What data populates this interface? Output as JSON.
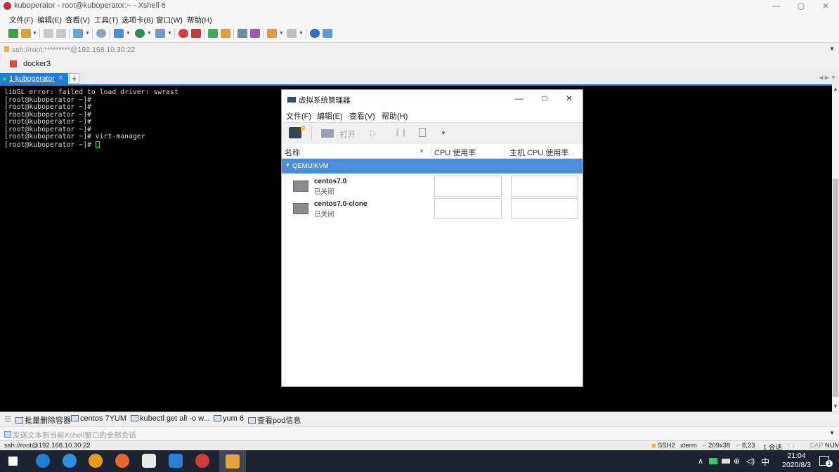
{
  "window": {
    "title": "kuboperator - root@kuboperator:~ - Xshell 6",
    "controls": [
      "—",
      "▢",
      "✕"
    ]
  },
  "menubar": [
    "文件(F)",
    "编辑(E)",
    "查看(V)",
    "工具(T)",
    "选项卡(B)",
    "窗口(W)",
    "帮助(H)"
  ],
  "address": "ssh://root:*********@192.168.10.30:22",
  "session_bar": {
    "label": "docker3"
  },
  "tabs": [
    {
      "label": "1 kuboperator",
      "close": "×"
    }
  ],
  "add_tab": "+",
  "terminal": {
    "lines": [
      "libGL error: failed to load driver: swrast",
      "[root@kuboperator ~]#",
      "[root@kuboperator ~]#",
      "[root@kuboperator ~]#",
      "[root@kuboperator ~]#",
      "[root@kuboperator ~]#",
      "[root@kuboperator ~]# virt-manager",
      "[root@kuboperator ~]# "
    ]
  },
  "virt_manager": {
    "title": "虚拟系统管理器",
    "controls": [
      "—",
      "□",
      "✕"
    ],
    "menu": [
      "文件(F)",
      "编辑(E)",
      "查看(V)",
      "帮助(H)"
    ],
    "toolbar": {
      "open_label": "打开"
    },
    "columns": {
      "name": "名称",
      "cpu": "CPU 使用率",
      "host_cpu": "主机 CPU 使用率"
    },
    "group": "QEMU/KVM",
    "vms": [
      {
        "name": "centos7.0",
        "state": "已关闭"
      },
      {
        "name": "centos7.0-clone",
        "state": "已关闭"
      }
    ]
  },
  "quick_commands": [
    "批量删除容器",
    "centos 7YUM",
    "kubectl get all -o w...",
    "yum 6",
    "查看pod信息"
  ],
  "send_bar": {
    "placeholder": "发送文本到当前Xshell窗口的全部会话"
  },
  "status": {
    "left": "ssh://root@192.168.10.30:22",
    "protocol": "SSH2",
    "term": "xterm",
    "size": "209x38",
    "pos": "8,23",
    "sessions": "1 会话",
    "caps": "CAP",
    "num": "NUM"
  },
  "taskbar": {
    "time": "21:04",
    "date": "2020/8/3",
    "ime": "中",
    "notify_count": "1"
  },
  "colors": {
    "accent": "#1e7ed8",
    "group_bg": "#4a90d9",
    "terminal_bg": "#000000",
    "taskbar_bg": "#1c2431"
  }
}
